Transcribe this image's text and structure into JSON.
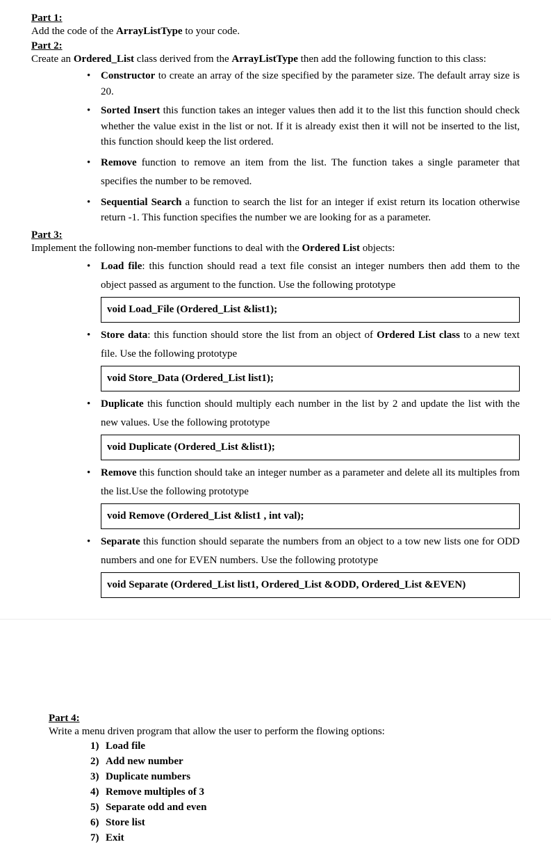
{
  "part1": {
    "heading": "Part 1:",
    "intro": "Add the code of the ArrayListType to your code."
  },
  "part2": {
    "heading": "Part 2:",
    "intro_pre": "Create an ",
    "intro_bold1": "Ordered_List",
    "intro_mid": " class derived from the ",
    "intro_bold2": "ArrayListType",
    "intro_post": " then add the following function to this class:",
    "items": [
      {
        "bold": "Constructor",
        "text": " to create an array of the size specified by the parameter size. The default array size is 20."
      },
      {
        "bold": "Sorted Insert",
        "text": " this function takes an integer values then add it to the list this function should check whether the value exist in the list or not. If it is already exist then it will not be inserted to the list, this function should keep the list ordered."
      },
      {
        "bold": "Remove",
        "text": " function to remove an item from the list. The function takes a single parameter that specifies the number to be removed."
      },
      {
        "bold": "Sequential Search",
        "text": " a function to search the list for an integer if exist return its location otherwise return -1. This function specifies the number we are looking for as a parameter."
      }
    ]
  },
  "part3": {
    "heading": "Part 3:",
    "intro_pre": "Implement the following non-member functions to deal with the ",
    "intro_bold": "Ordered List",
    "intro_post": " objects:",
    "items": [
      {
        "bold": "Load file",
        "text": ": this function should read a text file consist an integer numbers then add them to the object passed as argument to the function. Use the following prototype",
        "proto": "void Load_File (Ordered_List &list1);"
      },
      {
        "bold": "Store data",
        "text_pre": ": this function should store the list from an object of ",
        "text_bold": "Ordered List class",
        "text_post": " to a new text file. Use the following prototype",
        "proto": "void Store_Data (Ordered_List list1);"
      },
      {
        "bold": "Duplicate",
        "text": " this function should multiply each number in the list by 2 and update the list with the new values. Use the following prototype",
        "proto": "void Duplicate (Ordered_List &list1);"
      },
      {
        "bold": "Remove",
        "text": " this function should take an integer number as a parameter and delete all its multiples from the list.Use the following prototype",
        "proto": "void Remove (Ordered_List &list1 , int val);"
      },
      {
        "bold": "Separate",
        "text": " this function should separate the numbers from an object to a tow new lists one for ODD numbers and one for EVEN numbers. Use the following prototype",
        "proto": "void Separate (Ordered_List list1, Ordered_List &ODD, Ordered_List &EVEN)"
      }
    ]
  },
  "part4": {
    "heading": "Part 4:",
    "intro": "Write a menu driven program that allow the user to perform the flowing options:",
    "menu": [
      {
        "num": "1)",
        "label": "Load file"
      },
      {
        "num": "2)",
        "label": "Add new number"
      },
      {
        "num": "3)",
        "label": "Duplicate numbers"
      },
      {
        "num": "4)",
        "label": "Remove multiples of 3"
      },
      {
        "num": "5)",
        "label": "Separate odd and even"
      },
      {
        "num": "6)",
        "label": "Store list"
      },
      {
        "num": "7)",
        "label": "Exit"
      }
    ]
  }
}
